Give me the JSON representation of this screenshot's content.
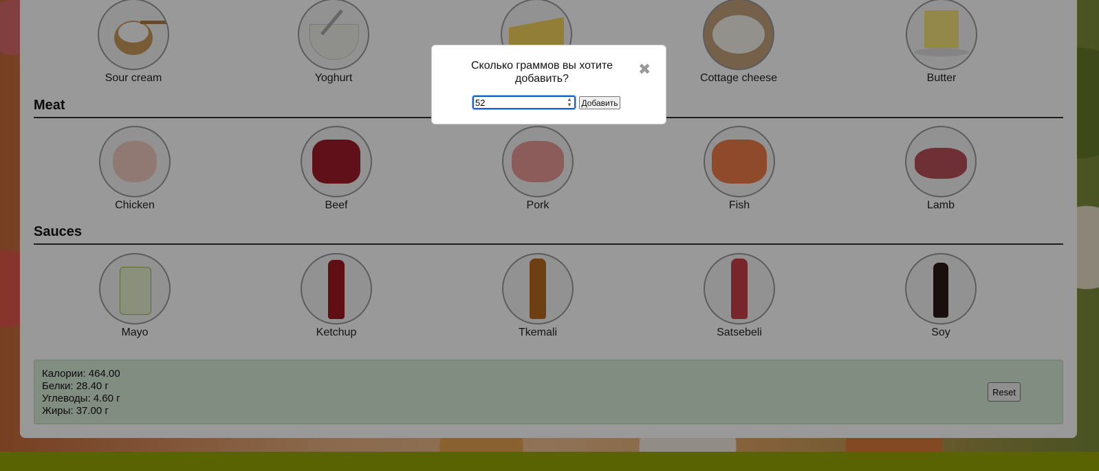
{
  "sections": {
    "dairy": {
      "items": [
        {
          "label": "Sour cream",
          "icon": "sour-cream-icon"
        },
        {
          "label": "Yoghurt",
          "icon": "yoghurt-icon"
        },
        {
          "label": "",
          "icon": "cheese-icon"
        },
        {
          "label": "Cottage cheese",
          "icon": "cottage-cheese-icon"
        },
        {
          "label": "Butter",
          "icon": "butter-icon"
        }
      ]
    },
    "meat": {
      "title": "Meat",
      "items": [
        {
          "label": "Chicken",
          "icon": "chicken-icon"
        },
        {
          "label": "Beef",
          "icon": "beef-icon"
        },
        {
          "label": "Pork",
          "icon": "pork-icon"
        },
        {
          "label": "Fish",
          "icon": "fish-icon"
        },
        {
          "label": "Lamb",
          "icon": "lamb-icon"
        }
      ]
    },
    "sauces": {
      "title": "Sauces",
      "items": [
        {
          "label": "Mayo",
          "icon": "mayo-icon"
        },
        {
          "label": "Ketchup",
          "icon": "ketchup-icon"
        },
        {
          "label": "Tkemali",
          "icon": "tkemali-icon"
        },
        {
          "label": "Satsebeli",
          "icon": "satsebeli-icon"
        },
        {
          "label": "Soy",
          "icon": "soy-icon"
        }
      ]
    }
  },
  "totals": {
    "calories": "Калории: 464.00",
    "protein": "Белки: 28.40 г",
    "carbs": "Углеводы: 4.60 г",
    "fat": "Жиры: 37.00 г",
    "reset_label": "Reset"
  },
  "modal": {
    "prompt": "Сколько граммов вы хотите добавить?",
    "close_glyph": "✖",
    "input_value": "52",
    "add_label": "Добавить"
  }
}
